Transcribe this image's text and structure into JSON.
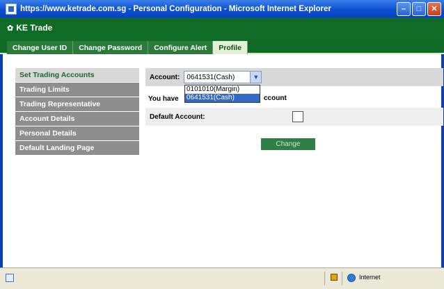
{
  "window": {
    "title": "https://www.ketrade.com.sg - Personal Configuration - Microsoft Internet Explorer",
    "minimize": "–",
    "maximize": "□",
    "close": "✕"
  },
  "app": {
    "logo_glyph": "✿",
    "name": "KE Trade"
  },
  "tabs": [
    {
      "label": "Change User ID"
    },
    {
      "label": "Change Password"
    },
    {
      "label": "Configure Alert"
    },
    {
      "label": "Profile",
      "active": true
    }
  ],
  "sidebar": {
    "items": [
      {
        "label": "Set Trading Accounts",
        "active": true
      },
      {
        "label": "Trading Limits"
      },
      {
        "label": "Trading Representative"
      },
      {
        "label": "Account Details"
      },
      {
        "label": "Personal Details"
      },
      {
        "label": "Default Landing Page"
      }
    ]
  },
  "form": {
    "account_label": "Account:",
    "account_value": "0641531(Cash)",
    "info_text_start": "You have",
    "info_text_end": "ccount",
    "default_label": "Default Account:",
    "change_button": "Change",
    "dropdown_options": [
      {
        "label": "0101010(Margin)",
        "selected": false
      },
      {
        "label": "0641531(Cash)",
        "selected": true
      }
    ]
  },
  "status": {
    "zone": "Internet"
  },
  "colors": {
    "titlebar": "#0a4fd0",
    "appbar": "#0f6b26",
    "accent_green": "#2f7f46",
    "sidebar_item": "#8e8e8e",
    "selection": "#316ac5"
  }
}
